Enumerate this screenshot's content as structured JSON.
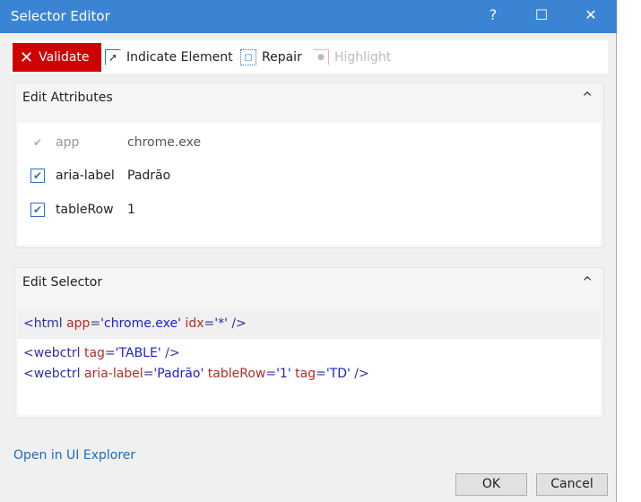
{
  "window": {
    "title": "Selector Editor",
    "help": "?",
    "maximize": "☐",
    "close": "✕"
  },
  "toolbar": {
    "validate": "Validate",
    "indicate": "Indicate Element",
    "repair": "Repair",
    "highlight": "Highlight"
  },
  "attributes": {
    "title": "Edit Attributes",
    "rows": [
      {
        "name": "app",
        "value": "chrome.exe",
        "checked": true,
        "disabled": true
      },
      {
        "name": "aria-label",
        "value": "Padrão",
        "checked": true,
        "disabled": false
      },
      {
        "name": "tableRow",
        "value": "1",
        "checked": true,
        "disabled": false
      }
    ]
  },
  "selector": {
    "title": "Edit Selector",
    "line1": {
      "open": "<html ",
      "a1": "app",
      "eq1": "=",
      "v1": "'chrome.exe'",
      "a2": " idx",
      "eq2": "=",
      "v2": "'*'",
      "close": " />"
    },
    "line2": {
      "open": "<webctrl ",
      "a1": "tag",
      "eq1": "=",
      "v1": "'TABLE'",
      "close": " />"
    },
    "line3": {
      "open": "<webctrl ",
      "a1": "aria-label",
      "eq1": "=",
      "v1": "'Padrão'",
      "a2": " tableRow",
      "eq2": "=",
      "v2": "'1'",
      "a3": " tag",
      "eq3": "=",
      "v3": "'TD'",
      "close": " />"
    }
  },
  "footer": {
    "link": "Open in UI Explorer",
    "ok": "OK",
    "cancel": "Cancel"
  },
  "collapse_icon": "^"
}
